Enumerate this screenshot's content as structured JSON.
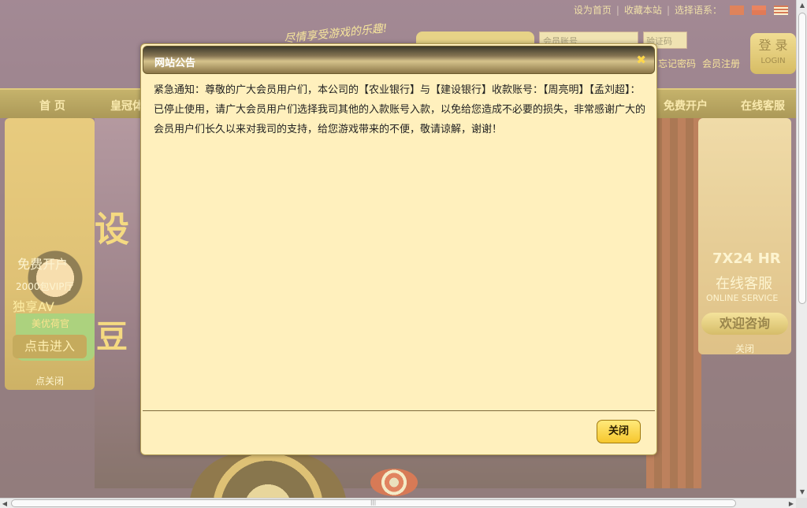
{
  "topbar": {
    "set_home": "设为首页",
    "bookmark": "收藏本站",
    "language": "选择语系："
  },
  "header": {
    "slogan": "尽情享受游戏的乐趣!",
    "account_placeholder": "会员账号",
    "code_placeholder": "验证码",
    "login_label": "登 录",
    "login_sub": "LOGIN",
    "forgot": "忘记密码",
    "register": "会员注册"
  },
  "nav": {
    "home": "首 页",
    "crown": "皇冠体",
    "free_signup": "免费开户",
    "online_service": "在线客服"
  },
  "ads": {
    "left": {
      "title": "免费开户",
      "vip": "2000包VIP厅",
      "av": "独享AV",
      "beauty": "美优荷官",
      "enter": "点击进入",
      "close": "点关闭"
    },
    "right": {
      "hours": "7X24 HR",
      "service": "在线客服",
      "service_en": "ONLINE SERVICE",
      "consult": "欢迎咨询",
      "close": "关闭"
    }
  },
  "modal": {
    "title": "网站公告",
    "close_icon": "✖",
    "message": "紧急通知：尊敬的广大会员用户们，本公司的【农业银行】与【建设银行】收款账号：【周亮明】【孟刘超】：已停止使用，请广大会员用户们选择我司其他的入款账号入款，以免给您造成不必要的损失，非常感谢广大的会员用户们长久以来对我司的支持，给您游戏带来的不便，敬请谅解，谢谢！",
    "close_button": "关闭"
  },
  "colors": {
    "modal_bg": "#fff0bd",
    "button_bg": "#f6c72d",
    "page_bg": "#4a2f7c"
  }
}
